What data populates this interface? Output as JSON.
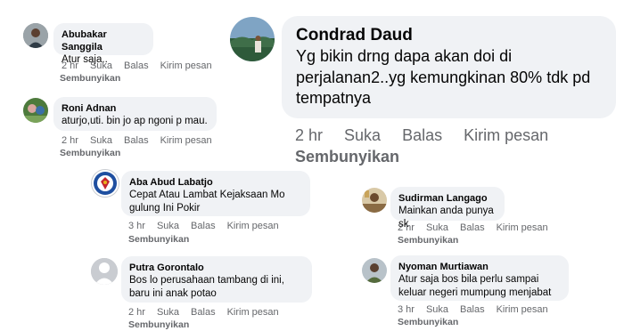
{
  "actions": {
    "like": "Suka",
    "reply": "Balas",
    "send": "Kirim pesan",
    "hide": "Sembunyikan"
  },
  "comments": [
    {
      "author": "Abubakar Sanggila",
      "text": "Atur saja..",
      "time": "2 hr"
    },
    {
      "author": "Roni Adnan",
      "text": "aturjo,uti. bin jo ap ngoni p mau.",
      "time": "2 hr"
    },
    {
      "author": "Aba Abud Labatjo",
      "text": "Cepat Atau Lambat Kejaksaan Mo gulung Ini Pokir",
      "time": "3 hr"
    },
    {
      "author": "Putra Gorontalo",
      "text": "Bos lo perusahaan tambang di ini, baru ini anak potao",
      "time": "2 hr"
    },
    {
      "author": "Condrad Daud",
      "text": "Yg bikin drng dapa akan doi di perjalanan2..yg kemungkinan 80% tdk pd tempatnya",
      "time": "2 hr"
    },
    {
      "author": "Sudirman Langago",
      "text": "Mainkan anda punya sk",
      "time": "2 hr"
    },
    {
      "author": "Nyoman Murtiawan",
      "text": "Atur saja bos bila perlu sampai keluar negeri mumpung menjabat",
      "time": "3 hr"
    }
  ]
}
